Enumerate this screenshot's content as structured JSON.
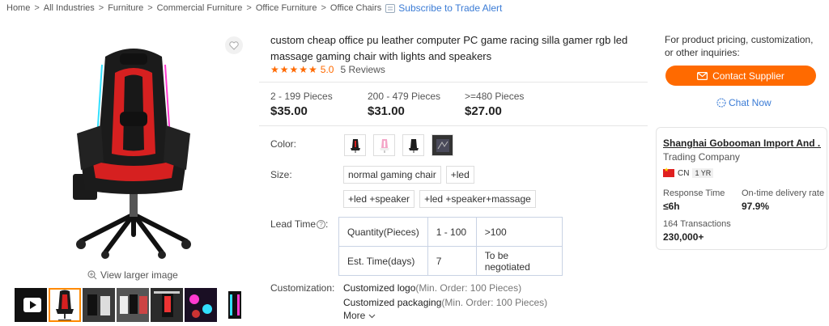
{
  "breadcrumb": {
    "items": [
      "Home",
      "All Industries",
      "Furniture",
      "Commercial Furniture",
      "Office Furniture",
      "Office Chairs"
    ],
    "subscribe": "Subscribe to Trade Alert"
  },
  "gallery": {
    "view_larger": "View larger image",
    "thumb_count": 7
  },
  "product": {
    "title": "custom cheap office pu leather computer PC game racing silla gamer rgb led massage gaming chair with lights and speakers",
    "stars": "★★★★★",
    "rating": "5.0",
    "reviews": "5 Reviews",
    "tiers": [
      {
        "qty": "2 - 199 Pieces",
        "price": "$35.00"
      },
      {
        "qty": "200 - 479 Pieces",
        "price": "$31.00"
      },
      {
        "qty": ">=480 Pieces",
        "price": "$27.00"
      }
    ],
    "color_label": "Color:",
    "colors": [
      "black-red",
      "pink",
      "black",
      "dark-print"
    ],
    "size_label": "Size:",
    "sizes": [
      "normal gaming chair",
      "+led",
      "+led +speaker",
      "+led +speaker+massage"
    ],
    "lead_label": "Lead Time",
    "lead_help": "?",
    "lead_time": {
      "row1": [
        "Quantity(Pieces)",
        "1 - 100",
        ">100"
      ],
      "row2": [
        "Est. Time(days)",
        "7",
        "To be negotiated"
      ]
    },
    "custom_label": "Customization:",
    "customizations": [
      {
        "name": "Customized logo",
        "moq": "(Min. Order: 100 Pieces)"
      },
      {
        "name": "Customized packaging",
        "moq": "(Min. Order: 100 Pieces)"
      }
    ],
    "more": "More"
  },
  "inquiry": {
    "text": "For product pricing, customization, or other inquiries:",
    "contact_button": "Contact Supplier",
    "chat": "Chat Now"
  },
  "supplier": {
    "name": "Shanghai Gobooman Import And ...",
    "type": "Trading Company",
    "country": "CN",
    "years": "1 YR",
    "response_label": "Response Time",
    "response_value": "≤6h",
    "delivery_label": "On-time delivery rate",
    "delivery_value": "97.9%",
    "transactions_label": "164 Transactions",
    "transactions_value": "230,000+"
  },
  "colors": {
    "accent": "#ff6a00",
    "link": "#3a7bd5"
  }
}
